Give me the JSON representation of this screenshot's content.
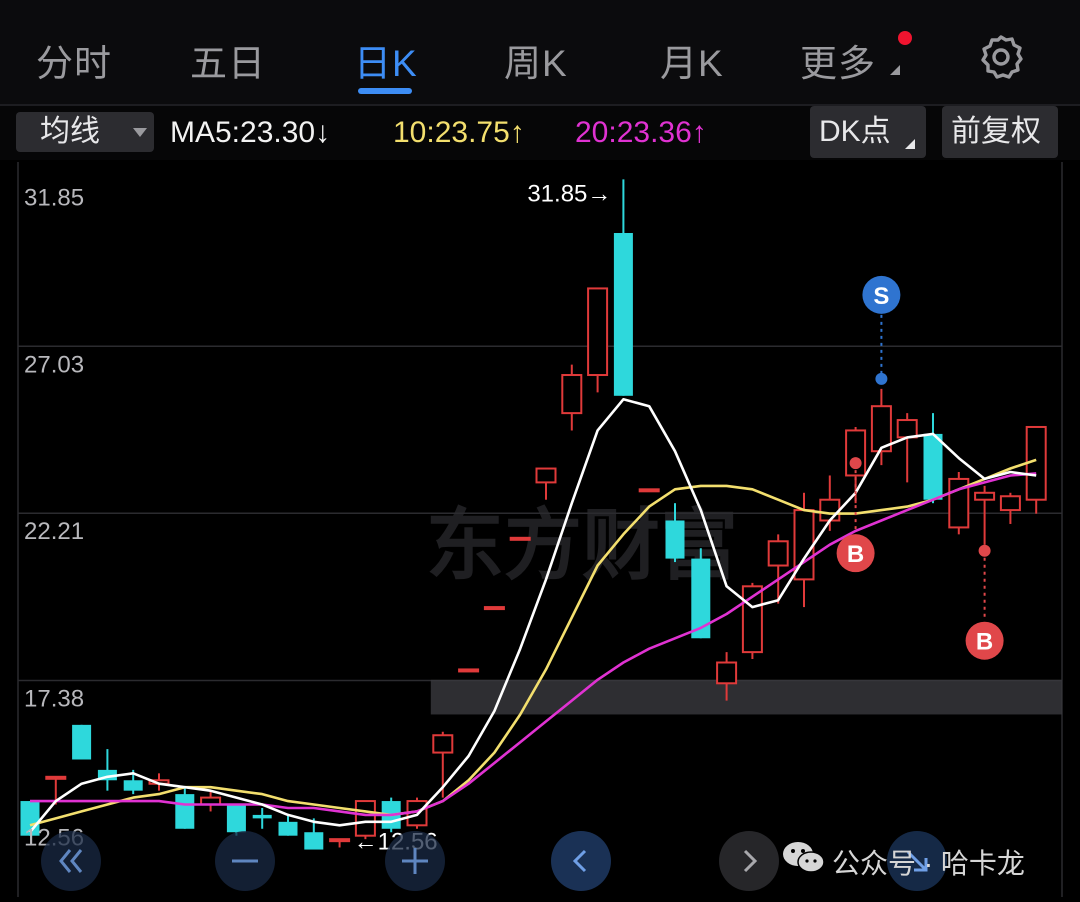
{
  "tabs": [
    {
      "label": "分时",
      "active": false
    },
    {
      "label": "五日",
      "active": false
    },
    {
      "label": "日K",
      "active": true
    },
    {
      "label": "周K",
      "active": false
    },
    {
      "label": "月K",
      "active": false
    },
    {
      "label": "更多",
      "active": false
    }
  ],
  "settings_icon": "gear-icon",
  "more_badge": "red-dot",
  "indicator_select": "均线",
  "ma": {
    "ma5": "MA5:23.30↓",
    "ma10": "10:23.75↑",
    "ma20": "20:23.36↑"
  },
  "colors": {
    "up": "#e03a3a",
    "down": "#2ed8dc",
    "ma5": "#ffffff",
    "ma10": "#f3df6e",
    "ma20": "#e032d2",
    "accent": "#3d8df5",
    "signal_b": "#e0474a",
    "signal_s": "#2f74d0"
  },
  "dk_button": "DK点",
  "adjust_button": "前复权",
  "watermark": "东方财富",
  "source_tag": "公众号 · 哈卡龙",
  "nav_icons": [
    "double-chevron-left-icon",
    "minus-icon",
    "plus-icon",
    "chevron-left-icon",
    "chevron-right-icon",
    "arrow-down-right-icon"
  ],
  "chart_data": {
    "type": "candlestick",
    "y_ticks": [
      "31.85",
      "27.03",
      "22.21",
      "17.38",
      "12.56"
    ],
    "ylim": [
      12.56,
      31.85
    ],
    "high_label": "31.85→",
    "low_label": "←12.56",
    "candles": [
      {
        "o": 13.9,
        "h": 13.9,
        "l": 12.9,
        "c": 12.9
      },
      {
        "o": 14.6,
        "h": 14.6,
        "l": 13.8,
        "c": 14.6
      },
      {
        "o": 16.1,
        "h": 16.1,
        "l": 15.1,
        "c": 15.1
      },
      {
        "o": 14.8,
        "h": 15.4,
        "l": 14.2,
        "c": 14.5
      },
      {
        "o": 14.5,
        "h": 14.8,
        "l": 14.1,
        "c": 14.2
      },
      {
        "o": 14.4,
        "h": 14.7,
        "l": 14.2,
        "c": 14.5
      },
      {
        "o": 14.1,
        "h": 14.3,
        "l": 13.1,
        "c": 13.1
      },
      {
        "o": 13.8,
        "h": 14.2,
        "l": 13.6,
        "c": 14.0
      },
      {
        "o": 13.8,
        "h": 13.8,
        "l": 12.9,
        "c": 13.0
      },
      {
        "o": 13.5,
        "h": 13.7,
        "l": 13.1,
        "c": 13.4
      },
      {
        "o": 13.3,
        "h": 13.5,
        "l": 12.9,
        "c": 12.9
      },
      {
        "o": 13.0,
        "h": 13.4,
        "l": 12.6,
        "c": 12.5
      },
      {
        "o": 12.8,
        "h": 12.8,
        "l": 12.56,
        "c": 12.8
      },
      {
        "o": 12.9,
        "h": 13.9,
        "l": 12.8,
        "c": 13.9
      },
      {
        "o": 13.9,
        "h": 14.0,
        "l": 13.0,
        "c": 13.1
      },
      {
        "o": 13.2,
        "h": 14.0,
        "l": 13.1,
        "c": 13.9
      },
      {
        "o": 15.3,
        "h": 15.9,
        "l": 14.0,
        "c": 15.8
      },
      {
        "o": 17.7,
        "h": 17.7,
        "l": 17.7,
        "c": 17.7
      },
      {
        "o": 19.5,
        "h": 19.5,
        "l": 19.5,
        "c": 19.5
      },
      {
        "o": 21.5,
        "h": 21.5,
        "l": 21.5,
        "c": 21.5
      },
      {
        "o": 23.1,
        "h": 23.3,
        "l": 22.6,
        "c": 23.5
      },
      {
        "o": 25.1,
        "h": 26.5,
        "l": 24.6,
        "c": 26.2
      },
      {
        "o": 26.2,
        "h": 28.7,
        "l": 25.7,
        "c": 28.7
      },
      {
        "o": 30.3,
        "h": 31.85,
        "l": 25.6,
        "c": 25.6
      },
      {
        "o": 22.9,
        "h": 22.9,
        "l": 22.9,
        "c": 22.9
      },
      {
        "o": 22.0,
        "h": 22.5,
        "l": 20.8,
        "c": 20.9
      },
      {
        "o": 20.9,
        "h": 21.2,
        "l": 18.6,
        "c": 18.6
      },
      {
        "o": 17.3,
        "h": 18.2,
        "l": 16.8,
        "c": 17.9
      },
      {
        "o": 18.2,
        "h": 20.2,
        "l": 18.0,
        "c": 20.1
      },
      {
        "o": 20.7,
        "h": 21.6,
        "l": 19.6,
        "c": 21.4
      },
      {
        "o": 20.3,
        "h": 22.8,
        "l": 19.5,
        "c": 22.3
      },
      {
        "o": 22.0,
        "h": 23.3,
        "l": 21.7,
        "c": 22.6
      },
      {
        "o": 23.3,
        "h": 24.7,
        "l": 22.5,
        "c": 24.6
      },
      {
        "o": 24.0,
        "h": 25.8,
        "l": 23.6,
        "c": 25.3
      },
      {
        "o": 24.4,
        "h": 25.1,
        "l": 23.1,
        "c": 24.9
      },
      {
        "o": 24.5,
        "h": 25.1,
        "l": 22.5,
        "c": 22.6
      },
      {
        "o": 21.8,
        "h": 23.4,
        "l": 21.6,
        "c": 23.2
      },
      {
        "o": 22.6,
        "h": 23.0,
        "l": 21.3,
        "c": 22.8
      },
      {
        "o": 22.3,
        "h": 22.8,
        "l": 21.9,
        "c": 22.7
      },
      {
        "o": 22.6,
        "h": 24.7,
        "l": 22.2,
        "c": 24.7
      }
    ],
    "ma5": [
      13.0,
      13.9,
      14.4,
      14.6,
      14.7,
      14.4,
      14.3,
      14.2,
      14.0,
      13.8,
      13.5,
      13.3,
      13.2,
      13.3,
      13.3,
      13.5,
      14.3,
      15.2,
      16.5,
      18.3,
      20.3,
      22.5,
      24.6,
      25.5,
      25.3,
      24.0,
      22.3,
      20.1,
      19.5,
      19.7,
      20.9,
      22.0,
      22.8,
      24.1,
      24.4,
      24.5,
      23.8,
      23.2,
      23.4,
      23.3
    ],
    "ma10": [
      13.2,
      13.4,
      13.6,
      13.8,
      14.0,
      14.1,
      14.3,
      14.3,
      14.2,
      14.1,
      13.9,
      13.8,
      13.7,
      13.6,
      13.5,
      13.6,
      13.9,
      14.5,
      15.3,
      16.4,
      17.7,
      19.2,
      20.7,
      21.6,
      22.4,
      22.9,
      23.0,
      23.0,
      22.9,
      22.6,
      22.3,
      22.2,
      22.2,
      22.3,
      22.4,
      22.6,
      22.9,
      23.2,
      23.5,
      23.75
    ],
    "ma20": [
      13.9,
      13.9,
      13.9,
      13.9,
      13.9,
      13.9,
      13.8,
      13.8,
      13.8,
      13.8,
      13.7,
      13.7,
      13.6,
      13.5,
      13.5,
      13.6,
      13.9,
      14.4,
      15.0,
      15.6,
      16.2,
      16.8,
      17.4,
      17.9,
      18.3,
      18.6,
      18.9,
      19.3,
      19.8,
      20.3,
      20.8,
      21.3,
      21.7,
      22.0,
      22.3,
      22.6,
      22.9,
      23.1,
      23.3,
      23.36
    ],
    "highlight_band": {
      "from_index": 16,
      "y_top": 17.4,
      "y_bottom": 16.4
    },
    "signals": [
      {
        "label": "S",
        "type": "sell",
        "index": 33
      },
      {
        "label": "B",
        "type": "buy",
        "index": 32
      },
      {
        "label": "B",
        "type": "buy",
        "index": 37
      }
    ]
  }
}
